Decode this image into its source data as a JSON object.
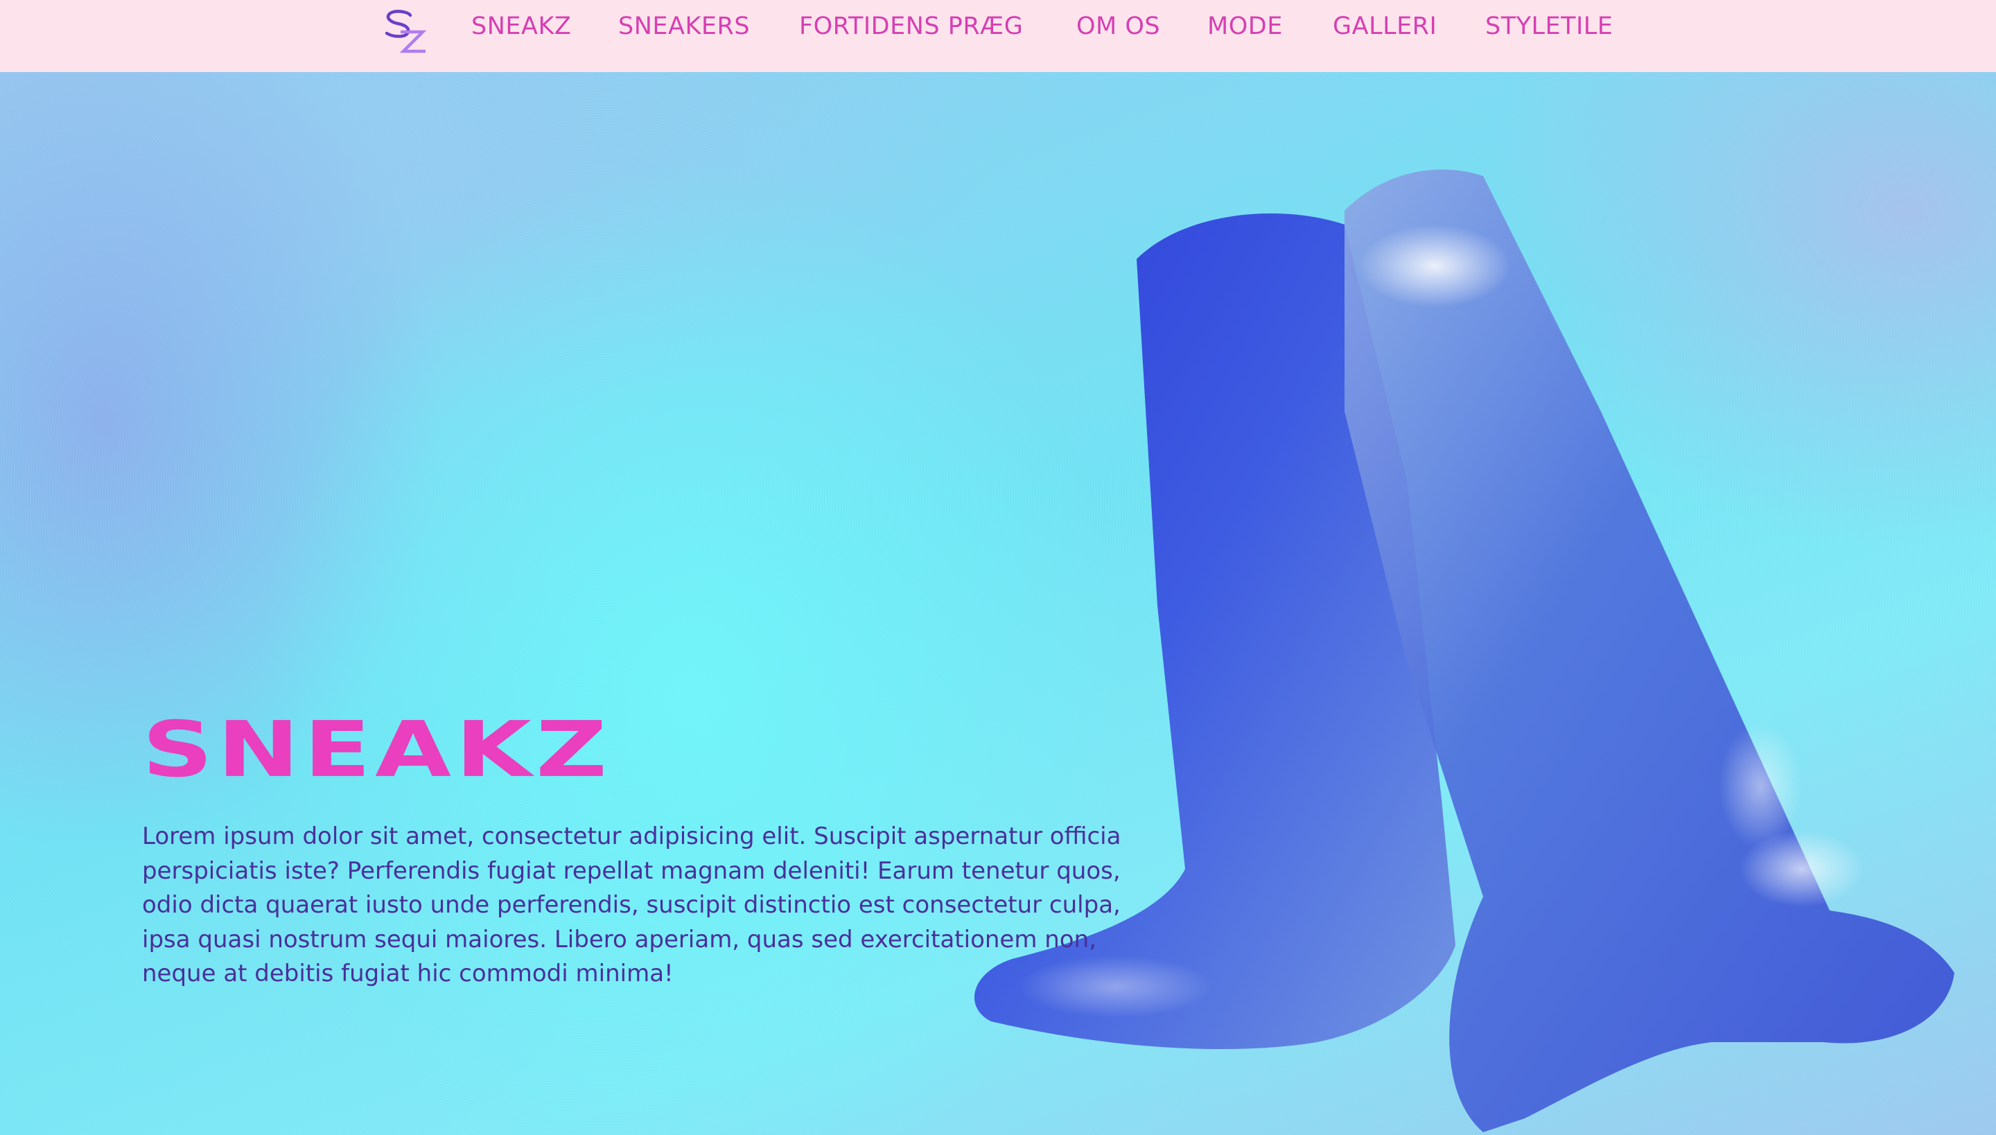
{
  "nav": {
    "logo_text": "SZ",
    "items": [
      {
        "label": "SNEAKZ"
      },
      {
        "label": "SNEAKERS"
      },
      {
        "label": "FORTIDENS PRÆG"
      },
      {
        "label": "OM OS"
      },
      {
        "label": "MODE"
      },
      {
        "label": "GALLERI"
      },
      {
        "label": "STYLETILE"
      }
    ]
  },
  "hero": {
    "title": "SNEAKZ",
    "body": "Lorem ipsum dolor sit amet, consectetur adipisicing elit. Suscipit aspernatur officia perspiciatis iste? Perferendis fugiat repellat magnam deleniti! Earum tenetur quos, odio dicta quaerat iusto unde perferendis, suscipit distinctio est consectetur culpa, ipsa quasi nostrum sequi maiores. Libero aperiam, quas sed exercitationem non, neque at debitis fugiat hic commodi minima!",
    "image": "boots-photo"
  },
  "colors": {
    "nav_bg": "#fde4ec",
    "nav_text": "#d63fb3",
    "title": "#ea3fbf",
    "body_text": "#4a2f9a"
  }
}
